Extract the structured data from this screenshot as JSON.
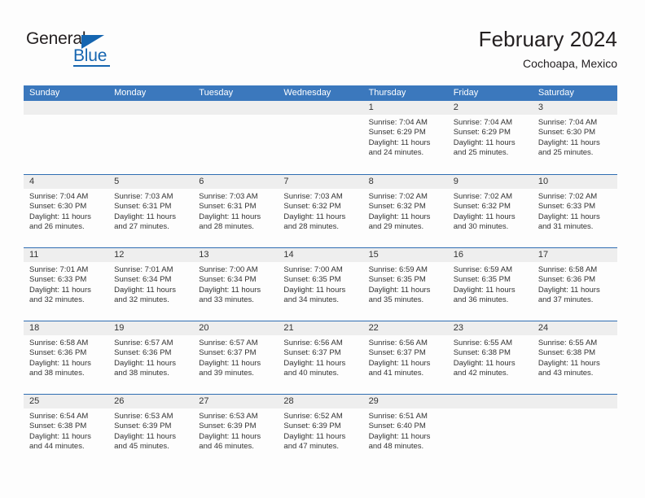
{
  "brand": {
    "name_part1": "General",
    "name_part2": "Blue",
    "triangle_icon": "triangle-icon",
    "accent_color": "#1565b0"
  },
  "header": {
    "title": "February 2024",
    "subtitle": "Cochoapa, Mexico"
  },
  "theme": {
    "header_blue": "#3b78bd",
    "row_divider_blue": "#2f6db2",
    "date_band_gray": "#eeeeee",
    "text_color": "#333333"
  },
  "calendar": {
    "weekday_headers": [
      "Sunday",
      "Monday",
      "Tuesday",
      "Wednesday",
      "Thursday",
      "Friday",
      "Saturday"
    ],
    "weeks": [
      [
        {
          "day": "",
          "sunrise": "",
          "sunset": "",
          "daylight_line1": "",
          "daylight_line2": ""
        },
        {
          "day": "",
          "sunrise": "",
          "sunset": "",
          "daylight_line1": "",
          "daylight_line2": ""
        },
        {
          "day": "",
          "sunrise": "",
          "sunset": "",
          "daylight_line1": "",
          "daylight_line2": ""
        },
        {
          "day": "",
          "sunrise": "",
          "sunset": "",
          "daylight_line1": "",
          "daylight_line2": ""
        },
        {
          "day": "1",
          "sunrise": "Sunrise: 7:04 AM",
          "sunset": "Sunset: 6:29 PM",
          "daylight_line1": "Daylight: 11 hours",
          "daylight_line2": "and 24 minutes."
        },
        {
          "day": "2",
          "sunrise": "Sunrise: 7:04 AM",
          "sunset": "Sunset: 6:29 PM",
          "daylight_line1": "Daylight: 11 hours",
          "daylight_line2": "and 25 minutes."
        },
        {
          "day": "3",
          "sunrise": "Sunrise: 7:04 AM",
          "sunset": "Sunset: 6:30 PM",
          "daylight_line1": "Daylight: 11 hours",
          "daylight_line2": "and 25 minutes."
        }
      ],
      [
        {
          "day": "4",
          "sunrise": "Sunrise: 7:04 AM",
          "sunset": "Sunset: 6:30 PM",
          "daylight_line1": "Daylight: 11 hours",
          "daylight_line2": "and 26 minutes."
        },
        {
          "day": "5",
          "sunrise": "Sunrise: 7:03 AM",
          "sunset": "Sunset: 6:31 PM",
          "daylight_line1": "Daylight: 11 hours",
          "daylight_line2": "and 27 minutes."
        },
        {
          "day": "6",
          "sunrise": "Sunrise: 7:03 AM",
          "sunset": "Sunset: 6:31 PM",
          "daylight_line1": "Daylight: 11 hours",
          "daylight_line2": "and 28 minutes."
        },
        {
          "day": "7",
          "sunrise": "Sunrise: 7:03 AM",
          "sunset": "Sunset: 6:32 PM",
          "daylight_line1": "Daylight: 11 hours",
          "daylight_line2": "and 28 minutes."
        },
        {
          "day": "8",
          "sunrise": "Sunrise: 7:02 AM",
          "sunset": "Sunset: 6:32 PM",
          "daylight_line1": "Daylight: 11 hours",
          "daylight_line2": "and 29 minutes."
        },
        {
          "day": "9",
          "sunrise": "Sunrise: 7:02 AM",
          "sunset": "Sunset: 6:32 PM",
          "daylight_line1": "Daylight: 11 hours",
          "daylight_line2": "and 30 minutes."
        },
        {
          "day": "10",
          "sunrise": "Sunrise: 7:02 AM",
          "sunset": "Sunset: 6:33 PM",
          "daylight_line1": "Daylight: 11 hours",
          "daylight_line2": "and 31 minutes."
        }
      ],
      [
        {
          "day": "11",
          "sunrise": "Sunrise: 7:01 AM",
          "sunset": "Sunset: 6:33 PM",
          "daylight_line1": "Daylight: 11 hours",
          "daylight_line2": "and 32 minutes."
        },
        {
          "day": "12",
          "sunrise": "Sunrise: 7:01 AM",
          "sunset": "Sunset: 6:34 PM",
          "daylight_line1": "Daylight: 11 hours",
          "daylight_line2": "and 32 minutes."
        },
        {
          "day": "13",
          "sunrise": "Sunrise: 7:00 AM",
          "sunset": "Sunset: 6:34 PM",
          "daylight_line1": "Daylight: 11 hours",
          "daylight_line2": "and 33 minutes."
        },
        {
          "day": "14",
          "sunrise": "Sunrise: 7:00 AM",
          "sunset": "Sunset: 6:35 PM",
          "daylight_line1": "Daylight: 11 hours",
          "daylight_line2": "and 34 minutes."
        },
        {
          "day": "15",
          "sunrise": "Sunrise: 6:59 AM",
          "sunset": "Sunset: 6:35 PM",
          "daylight_line1": "Daylight: 11 hours",
          "daylight_line2": "and 35 minutes."
        },
        {
          "day": "16",
          "sunrise": "Sunrise: 6:59 AM",
          "sunset": "Sunset: 6:35 PM",
          "daylight_line1": "Daylight: 11 hours",
          "daylight_line2": "and 36 minutes."
        },
        {
          "day": "17",
          "sunrise": "Sunrise: 6:58 AM",
          "sunset": "Sunset: 6:36 PM",
          "daylight_line1": "Daylight: 11 hours",
          "daylight_line2": "and 37 minutes."
        }
      ],
      [
        {
          "day": "18",
          "sunrise": "Sunrise: 6:58 AM",
          "sunset": "Sunset: 6:36 PM",
          "daylight_line1": "Daylight: 11 hours",
          "daylight_line2": "and 38 minutes."
        },
        {
          "day": "19",
          "sunrise": "Sunrise: 6:57 AM",
          "sunset": "Sunset: 6:36 PM",
          "daylight_line1": "Daylight: 11 hours",
          "daylight_line2": "and 38 minutes."
        },
        {
          "day": "20",
          "sunrise": "Sunrise: 6:57 AM",
          "sunset": "Sunset: 6:37 PM",
          "daylight_line1": "Daylight: 11 hours",
          "daylight_line2": "and 39 minutes."
        },
        {
          "day": "21",
          "sunrise": "Sunrise: 6:56 AM",
          "sunset": "Sunset: 6:37 PM",
          "daylight_line1": "Daylight: 11 hours",
          "daylight_line2": "and 40 minutes."
        },
        {
          "day": "22",
          "sunrise": "Sunrise: 6:56 AM",
          "sunset": "Sunset: 6:37 PM",
          "daylight_line1": "Daylight: 11 hours",
          "daylight_line2": "and 41 minutes."
        },
        {
          "day": "23",
          "sunrise": "Sunrise: 6:55 AM",
          "sunset": "Sunset: 6:38 PM",
          "daylight_line1": "Daylight: 11 hours",
          "daylight_line2": "and 42 minutes."
        },
        {
          "day": "24",
          "sunrise": "Sunrise: 6:55 AM",
          "sunset": "Sunset: 6:38 PM",
          "daylight_line1": "Daylight: 11 hours",
          "daylight_line2": "and 43 minutes."
        }
      ],
      [
        {
          "day": "25",
          "sunrise": "Sunrise: 6:54 AM",
          "sunset": "Sunset: 6:38 PM",
          "daylight_line1": "Daylight: 11 hours",
          "daylight_line2": "and 44 minutes."
        },
        {
          "day": "26",
          "sunrise": "Sunrise: 6:53 AM",
          "sunset": "Sunset: 6:39 PM",
          "daylight_line1": "Daylight: 11 hours",
          "daylight_line2": "and 45 minutes."
        },
        {
          "day": "27",
          "sunrise": "Sunrise: 6:53 AM",
          "sunset": "Sunset: 6:39 PM",
          "daylight_line1": "Daylight: 11 hours",
          "daylight_line2": "and 46 minutes."
        },
        {
          "day": "28",
          "sunrise": "Sunrise: 6:52 AM",
          "sunset": "Sunset: 6:39 PM",
          "daylight_line1": "Daylight: 11 hours",
          "daylight_line2": "and 47 minutes."
        },
        {
          "day": "29",
          "sunrise": "Sunrise: 6:51 AM",
          "sunset": "Sunset: 6:40 PM",
          "daylight_line1": "Daylight: 11 hours",
          "daylight_line2": "and 48 minutes."
        },
        {
          "day": "",
          "sunrise": "",
          "sunset": "",
          "daylight_line1": "",
          "daylight_line2": ""
        },
        {
          "day": "",
          "sunrise": "",
          "sunset": "",
          "daylight_line1": "",
          "daylight_line2": ""
        }
      ]
    ]
  }
}
